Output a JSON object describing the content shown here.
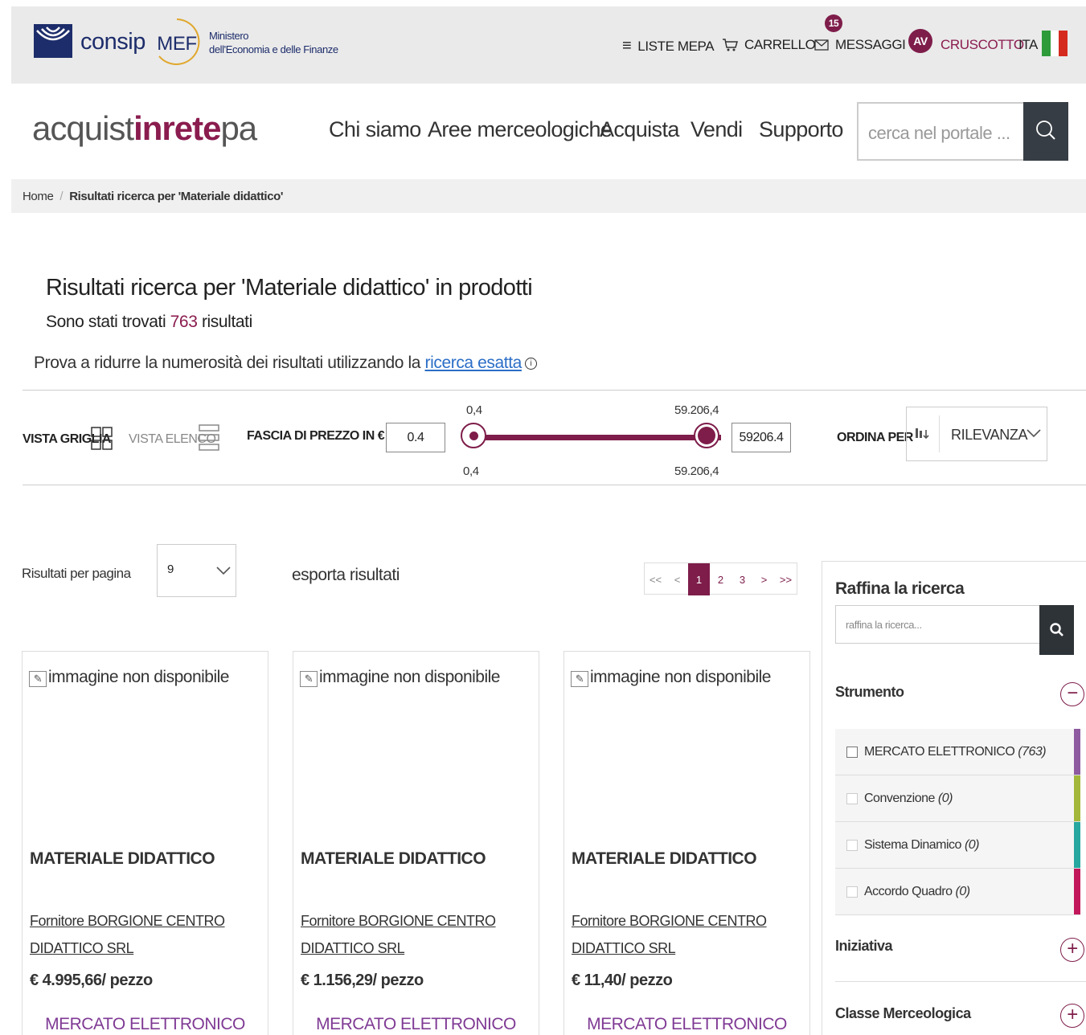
{
  "topbar": {
    "consip_label": "consip",
    "mef_abbr": "MEF",
    "mef_line1": "Ministero",
    "mef_line2": "dell'Economia e delle Finanze",
    "liste_mepa": "LISTE MEPA",
    "carrello": "CARRELLO",
    "messaggi": "MESSAGGI",
    "messages_badge": "15",
    "avatar_initials": "AV",
    "cruscotto": "CRUSCOTTO",
    "language": "ITA"
  },
  "header": {
    "brand_part1": "acquist",
    "brand_part2": "inrete",
    "brand_part3": "pa",
    "nav": [
      "Chi siamo",
      "Aree merceologiche",
      "Acquista",
      "Vendi",
      "Supporto"
    ],
    "search_placeholder": "cerca nel portale ..."
  },
  "breadcrumb": {
    "home": "Home",
    "current": "Risultati ricerca per 'Materiale didattico'"
  },
  "results": {
    "title": "Risultati ricerca per 'Materiale didattico' in prodotti",
    "count_prefix": "Sono stati trovati",
    "count": "763",
    "count_suffix": "risultati",
    "hint_text": "Prova a ridurre la numerosità dei risultati utilizzando la",
    "hint_link": "ricerca esatta",
    "info_icon": "i"
  },
  "filters": {
    "view_grid": "VISTA GRIGLIA",
    "view_list": "VISTA ELENCO",
    "price_label": "FASCIA DI PREZZO IN €",
    "price_min_input": "0.4",
    "price_max_input": "59206.4",
    "slider_min_label": "0,4",
    "slider_max_label": "59.206,4",
    "sort_label": "ORDINA PER",
    "sort_value": "RILEVANZA"
  },
  "toolbar": {
    "per_page_label": "Risultati per pagina",
    "per_page_value": "9",
    "export": "esporta risultati",
    "pager": [
      "<<",
      "<",
      "1",
      "2",
      "3",
      ">",
      ">>"
    ]
  },
  "products": [
    {
      "img_alt": "immagine non disponibile",
      "title": "MATERIALE DIDATTICO",
      "supplier": "Fornitore BORGIONE CENTRO DIDATTICO SRL",
      "price": "€ 4.995,66/ pezzo",
      "tool": "MERCATO ELETTRONICO"
    },
    {
      "img_alt": "immagine non disponibile",
      "title": "MATERIALE DIDATTICO",
      "supplier": "Fornitore BORGIONE CENTRO DIDATTICO SRL",
      "price": "€ 1.156,29/ pezzo",
      "tool": "MERCATO ELETTRONICO"
    },
    {
      "img_alt": "immagine non disponibile",
      "title": "MATERIALE DIDATTICO",
      "supplier": "Fornitore BORGIONE CENTRO DIDATTICO SRL",
      "price": "€ 11,40/ pezzo",
      "tool": "MERCATO ELETTRONICO"
    }
  ],
  "sidebar": {
    "title": "Raffina la ricerca",
    "search_placeholder": "raffina la ricerca...",
    "facet_strumento": "Strumento",
    "strumento_options": [
      {
        "label": "MERCATO ELETTRONICO",
        "count": "(763)",
        "color": "#8e5aa0"
      },
      {
        "label": "Convenzione",
        "count": "(0)",
        "color": "#a3b83a"
      },
      {
        "label": "Sistema Dinamico",
        "count": "(0)",
        "color": "#26a7a0"
      },
      {
        "label": "Accordo Quadro",
        "count": "(0)",
        "color": "#c2185b"
      }
    ],
    "facet_iniziativa": "Iniziativa",
    "facet_classe": "Classe Merceologica"
  },
  "colors": {
    "accent": "#7e1d4a",
    "tool_purple": "#7f3a94"
  }
}
